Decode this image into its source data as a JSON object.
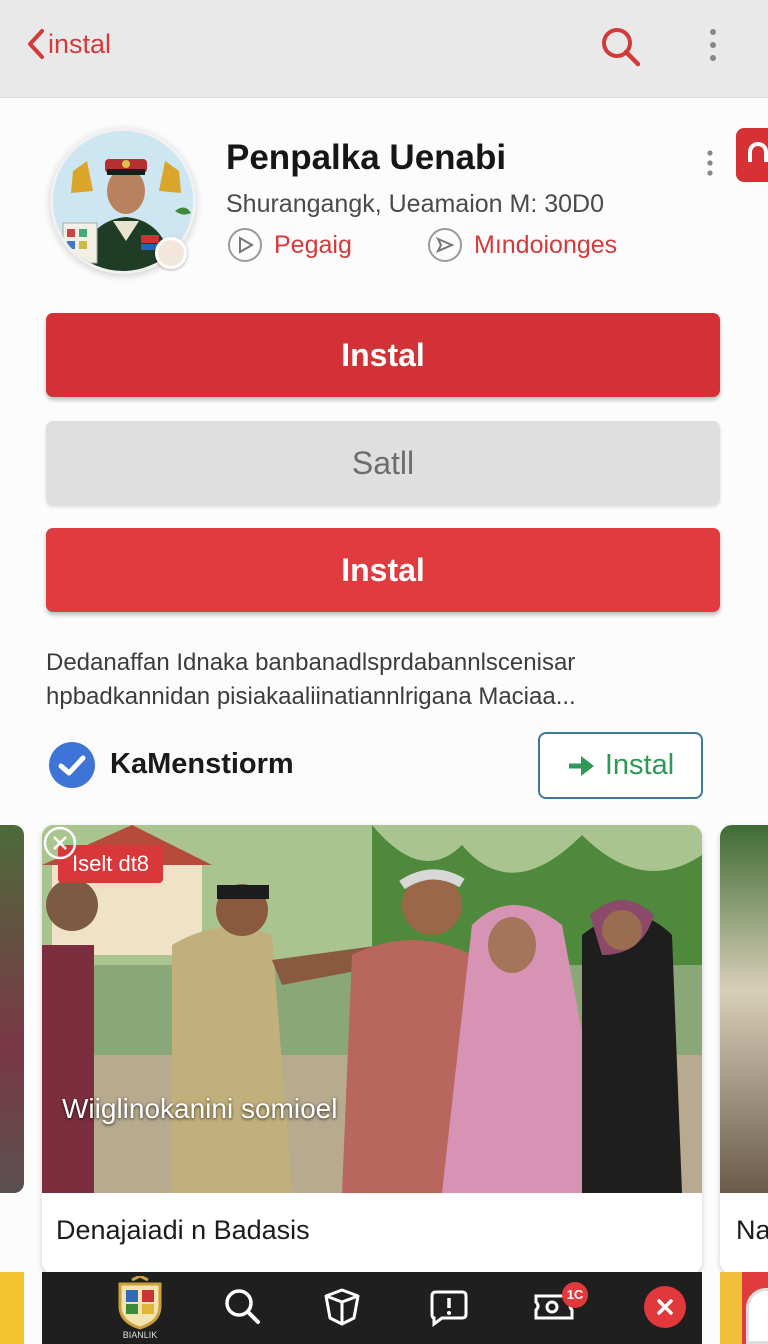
{
  "topbar": {
    "back_label": "instal",
    "search_icon": "search-icon",
    "more_icon": "more-vertical-icon"
  },
  "app": {
    "name": "Penpalka Uenabi",
    "subtitle": "Shurangangk, Ueamaion M: 30D0",
    "meta": [
      {
        "label": "Pegaig",
        "icon": "play-icon"
      },
      {
        "label": "Mındoionges",
        "icon": "send-icon"
      }
    ]
  },
  "buttons": {
    "primary": "Instal",
    "secondary": "Satll",
    "tertiary": "Instal"
  },
  "description": {
    "line1": "Dedanaffan Idnaka banbanadlsprdabannlscenisar",
    "line2": "hpbadkannidan pisiakaaliinatiannlrigana Maciaa..."
  },
  "developer": {
    "name": "KaMenstiorm",
    "install_label": "Instal"
  },
  "card": {
    "tag": "Iselt dt8",
    "caption": "Wiiglinokanini somioel",
    "title": "Denajaiadi n Badasis"
  },
  "next_card": {
    "title": "Na"
  },
  "bottom_nav": {
    "logo_text": "BIANLIK",
    "items": [
      "search-icon",
      "package-icon",
      "chat-icon",
      "ticket-icon"
    ],
    "badge": "1C",
    "close_icon": "close-icon"
  },
  "colors": {
    "accent": "#d23235",
    "secondary_btn": "#dfdfdf",
    "success": "#2f9a55",
    "verified": "#3d74d6"
  }
}
